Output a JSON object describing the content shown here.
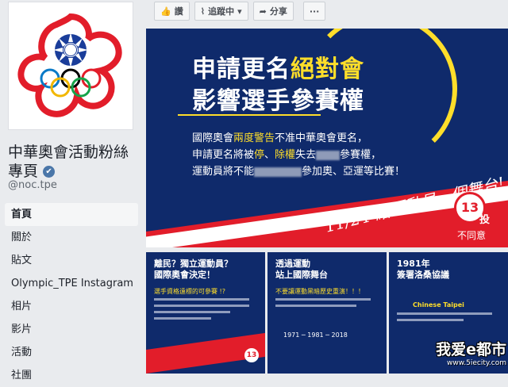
{
  "page": {
    "name": "中華奧會活動粉絲專頁",
    "handle": "@noc.tpe"
  },
  "nav": {
    "items": [
      {
        "label": "首頁"
      },
      {
        "label": "關於"
      },
      {
        "label": "貼文"
      },
      {
        "label": "Olympic_TPE Instagram"
      },
      {
        "label": "相片"
      },
      {
        "label": "影片"
      },
      {
        "label": "活動"
      },
      {
        "label": "社團"
      }
    ]
  },
  "toolbar": {
    "like_label": "讚",
    "follow_label": "追蹤中",
    "share_label": "分享",
    "more_label": "···"
  },
  "cover": {
    "headline_prefix": "申請更名",
    "headline_highlight": "絕對會",
    "headline_line2": "影響選手參賽權",
    "para1_a": "國際奧會",
    "para1_hl": "兩度警告",
    "para1_b": "不准中華奧會更名，",
    "para2_a": "申請更名將被",
    "para2_hl1": "停",
    "para2_sep": "、",
    "para2_hl2": "除權",
    "para2_b": "失去",
    "para2_c": "參賽權，",
    "para3_a": "運動員將不能",
    "para3_b": "參加奧、亞運等比賽！",
    "handwriting": "11/24 給運動員一個舞台!",
    "badge_num": "13",
    "vote_label": "投",
    "disagree_label": "不同意"
  },
  "tiles": [
    {
      "title_a": "離民？獨立運動員？",
      "title_b": "國際奧會決定！",
      "sub": "選手資格遠標的可參賽 !?"
    },
    {
      "title_a": "透過運動",
      "title_b": "站上國際舞台",
      "sub": "不要讓運動黑暗歷史重演！！！"
    },
    {
      "title_a": "1981年",
      "title_b": "簽署洛桑協議",
      "sub": "Chinese Taipei"
    }
  ],
  "tile_timeline": "1971 ─ 1981 ─ 2018",
  "tile_badge": "13",
  "watermark": {
    "line1": "我爱e都市",
    "line2": "www.5iecity.com"
  },
  "colors": {
    "navy": "#0f2a6b",
    "red": "#e21d2a",
    "yellow": "#ffde2a"
  }
}
